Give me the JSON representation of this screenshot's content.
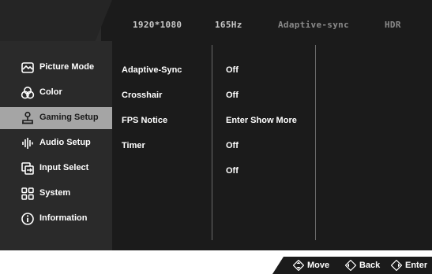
{
  "topbar": {
    "resolution": "1920*1080",
    "refresh_rate": "165Hz",
    "adaptive_sync": "Adaptive-sync",
    "hdr": "HDR"
  },
  "sidebar": {
    "items": [
      {
        "label": "Picture Mode",
        "icon": "picture-mode-icon"
      },
      {
        "label": "Color",
        "icon": "color-icon"
      },
      {
        "label": "Gaming Setup",
        "icon": "gaming-setup-icon",
        "active": true
      },
      {
        "label": "Audio Setup",
        "icon": "audio-setup-icon"
      },
      {
        "label": "Input Select",
        "icon": "input-select-icon"
      },
      {
        "label": "System",
        "icon": "system-icon"
      },
      {
        "label": "Information",
        "icon": "information-icon"
      }
    ]
  },
  "settings": {
    "labels": [
      "Adaptive-Sync",
      "Crosshair",
      "FPS Notice",
      "Timer"
    ],
    "values": [
      "Off",
      "Off",
      "Enter Show More",
      "Off",
      "Off"
    ]
  },
  "footer": {
    "move": "Move",
    "back": "Back",
    "enter": "Enter"
  },
  "colors": {
    "panel": "#1b1b1b",
    "sidebar": "#2a2a2a",
    "active": "#a5a5a5",
    "text": "#ffffff"
  }
}
